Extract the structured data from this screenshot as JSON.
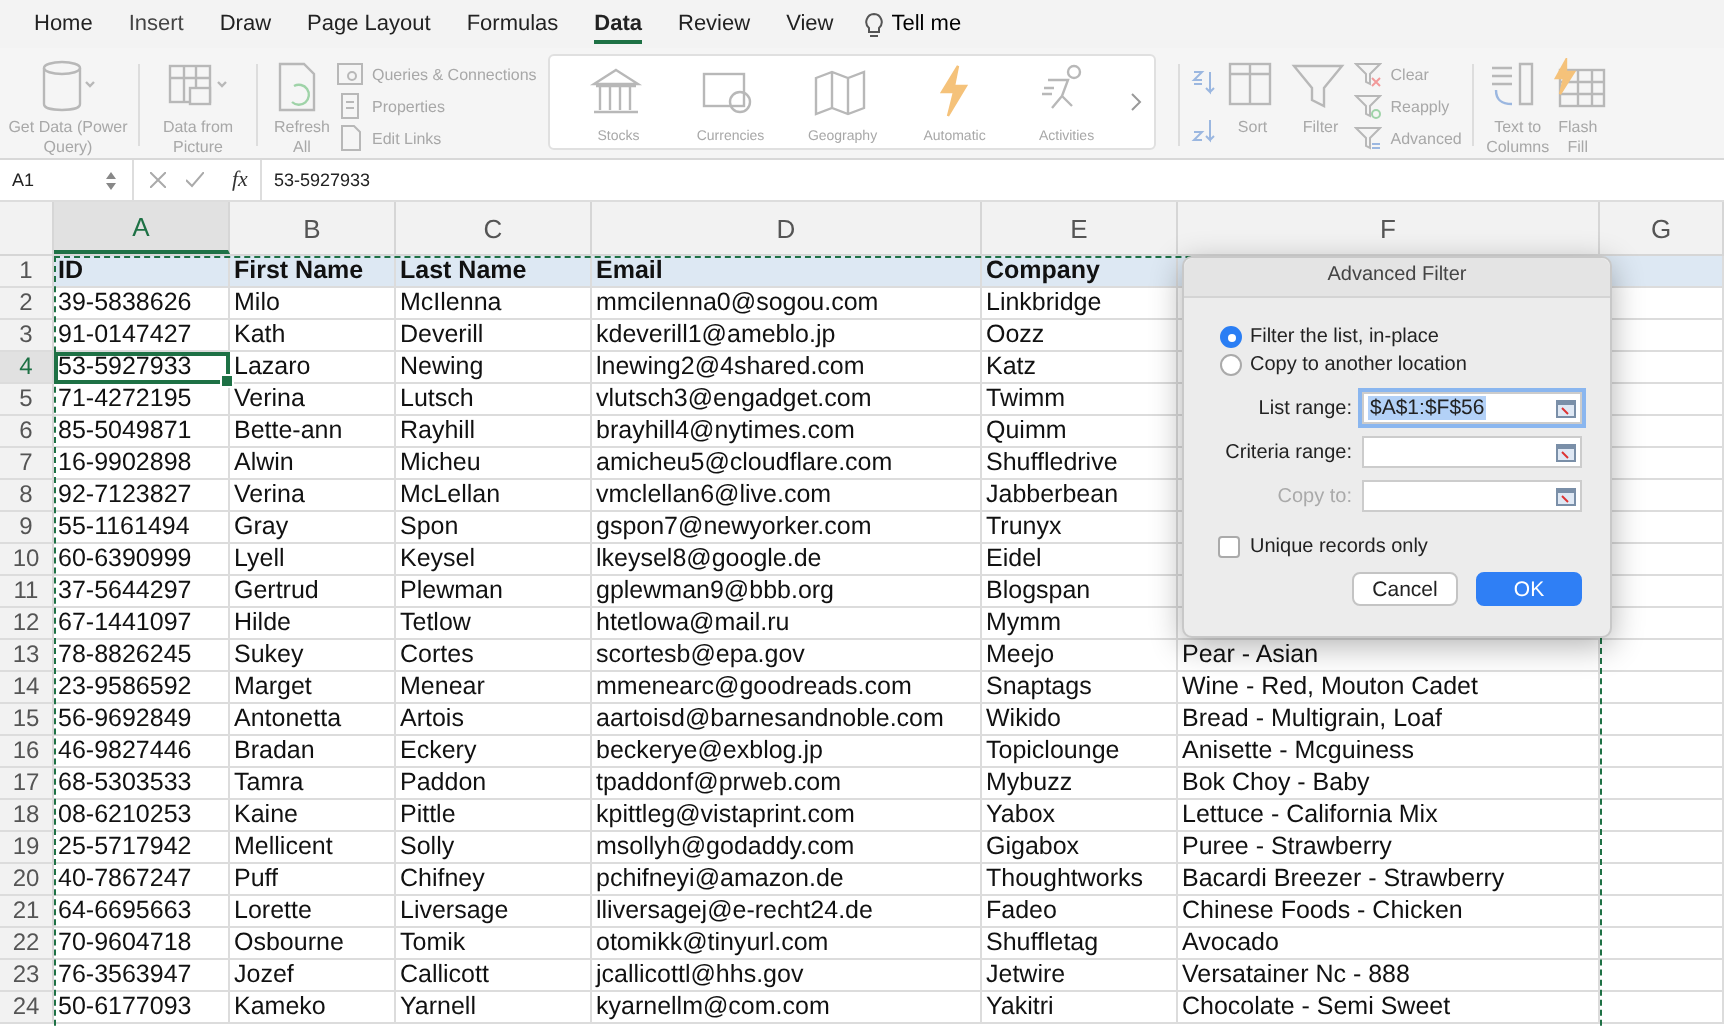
{
  "tabs": [
    {
      "label": "Home",
      "selected": false
    },
    {
      "label": "Insert",
      "selected": false
    },
    {
      "label": "Draw",
      "selected": false
    },
    {
      "label": "Page Layout",
      "selected": false
    },
    {
      "label": "Formulas",
      "selected": false
    },
    {
      "label": "Data",
      "selected": true
    },
    {
      "label": "Review",
      "selected": false
    },
    {
      "label": "View",
      "selected": false
    }
  ],
  "tell_me": "Tell me",
  "ribbon": {
    "get_data": "Get Data (Power Query)",
    "data_from_picture": "Data from Picture",
    "refresh_all": "Refresh All",
    "connections": [
      "Queries & Connections",
      "Properties",
      "Edit Links"
    ],
    "data_types": [
      "Stocks",
      "Currencies",
      "Geography",
      "Automatic",
      "Activities"
    ],
    "sort": "Sort",
    "filter": "Filter",
    "clear": "Clear",
    "reapply": "Reapply",
    "advanced": "Advanced",
    "text_to_columns": "Text to Columns",
    "flash_fill": "Flash Fill"
  },
  "formula_bar": {
    "name_box": "A1",
    "function_label": "fx",
    "formula": "53-5927933"
  },
  "columns": [
    {
      "label": "A",
      "selected": true
    },
    {
      "label": "B",
      "selected": false
    },
    {
      "label": "C",
      "selected": false
    },
    {
      "label": "D",
      "selected": false
    },
    {
      "label": "E",
      "selected": false
    },
    {
      "label": "F",
      "selected": false
    },
    {
      "label": "G",
      "selected": false
    }
  ],
  "rows": [
    {
      "number": "1",
      "selected": false,
      "kind": "header",
      "cells": [
        "ID",
        "First Name",
        "Last Name",
        "Email",
        "Company"
      ]
    },
    {
      "number": "2",
      "selected": false,
      "kind": "data",
      "cells": [
        "39-5838626",
        "Milo",
        "McIlenna",
        "mmcilenna0@sogou.com",
        "Linkbridge"
      ]
    },
    {
      "number": "3",
      "selected": false,
      "kind": "data",
      "cells": [
        "91-0147427",
        "Kath",
        "Deverill",
        "kdeverill1@ameblo.jp",
        "Oozz"
      ]
    },
    {
      "number": "4",
      "selected": true,
      "kind": "data",
      "cells": [
        "53-5927933",
        "Lazaro",
        "Newing",
        "lnewing2@4shared.com",
        "Katz"
      ]
    },
    {
      "number": "5",
      "selected": false,
      "kind": "data",
      "cells": [
        "71-4272195",
        "Verina",
        "Lutsch",
        "vlutsch3@engadget.com",
        "Twimm"
      ]
    },
    {
      "number": "6",
      "selected": false,
      "kind": "data",
      "cells": [
        "85-5049871",
        "Bette-ann",
        "Rayhill",
        "brayhill4@nytimes.com",
        "Quimm"
      ]
    },
    {
      "number": "7",
      "selected": false,
      "kind": "data",
      "cells": [
        "16-9902898",
        "Alwin",
        "Micheu",
        "amicheu5@cloudflare.com",
        "Shuffledrive"
      ]
    },
    {
      "number": "8",
      "selected": false,
      "kind": "data",
      "cells": [
        "92-7123827",
        "Verina",
        "McLellan",
        "vmclellan6@live.com",
        "Jabberbean"
      ]
    },
    {
      "number": "9",
      "selected": false,
      "kind": "data",
      "cells": [
        "55-1161494",
        "Gray",
        "Spon",
        "gspon7@newyorker.com",
        "Trunyx"
      ]
    },
    {
      "number": "10",
      "selected": false,
      "kind": "data",
      "cells": [
        "60-6390999",
        "Lyell",
        "Keysel",
        "lkeysel8@google.de",
        "Eidel"
      ]
    },
    {
      "number": "11",
      "selected": false,
      "kind": "data",
      "cells": [
        "37-5644297",
        "Gertrud",
        "Plewman",
        "gplewman9@bbb.org",
        "Blogspan"
      ]
    },
    {
      "number": "12",
      "selected": false,
      "kind": "data",
      "cells": [
        "67-1441097",
        "Hilde",
        "Tetlow",
        "htetlowa@mail.ru",
        "Mymm"
      ]
    },
    {
      "number": "13",
      "selected": false,
      "kind": "data",
      "cells": [
        "78-8826245",
        "Sukey",
        "Cortes",
        "scortesb@epa.gov",
        "Meejo",
        "Pear - Asian"
      ]
    },
    {
      "number": "14",
      "selected": false,
      "kind": "data",
      "cells": [
        "23-9586592",
        "Marget",
        "Menear",
        "mmenearc@goodreads.com",
        "Snaptags",
        "Wine - Red, Mouton Cadet"
      ]
    },
    {
      "number": "15",
      "selected": false,
      "kind": "data",
      "cells": [
        "56-9692849",
        "Antonetta",
        "Artois",
        "aartoisd@barnesandnoble.com",
        "Wikido",
        "Bread - Multigrain, Loaf"
      ]
    },
    {
      "number": "16",
      "selected": false,
      "kind": "data",
      "cells": [
        "46-9827446",
        "Bradan",
        "Eckery",
        "beckerye@exblog.jp",
        "Topiclounge",
        "Anisette - Mcguiness"
      ]
    },
    {
      "number": "17",
      "selected": false,
      "kind": "data",
      "cells": [
        "68-5303533",
        "Tamra",
        "Paddon",
        "tpaddonf@prweb.com",
        "Mybuzz",
        "Bok Choy - Baby"
      ]
    },
    {
      "number": "18",
      "selected": false,
      "kind": "data",
      "cells": [
        "08-6210253",
        "Kaine",
        "Pittle",
        "kpittleg@vistaprint.com",
        "Yabox",
        "Lettuce - California Mix"
      ]
    },
    {
      "number": "19",
      "selected": false,
      "kind": "data",
      "cells": [
        "25-5717942",
        "Mellicent",
        "Solly",
        "msollyh@godaddy.com",
        "Gigabox",
        "Puree - Strawberry"
      ]
    },
    {
      "number": "20",
      "selected": false,
      "kind": "data",
      "cells": [
        "40-7867247",
        "Puff",
        "Chifney",
        "pchifneyi@amazon.de",
        "Thoughtworks",
        "Bacardi Breezer - Strawberry"
      ]
    },
    {
      "number": "21",
      "selected": false,
      "kind": "data",
      "cells": [
        "64-6695663",
        "Lorette",
        "Liversage",
        "lliversagej@e-recht24.de",
        "Fadeo",
        "Chinese Foods - Chicken"
      ]
    },
    {
      "number": "22",
      "selected": false,
      "kind": "data",
      "cells": [
        "70-9604718",
        "Osbourne",
        "Tomik",
        "otomikk@tinyurl.com",
        "Shuffletag",
        "Avocado"
      ]
    },
    {
      "number": "23",
      "selected": false,
      "kind": "data",
      "cells": [
        "76-3563947",
        "Jozef",
        "Callicott",
        "jcallicottl@hhs.gov",
        "Jetwire",
        "Versatainer Nc - 888"
      ]
    },
    {
      "number": "24",
      "selected": false,
      "kind": "data",
      "cells": [
        "50-6177093",
        "Kameko",
        "Yarnell",
        "kyarnellm@com.com",
        "Yakitri",
        "Chocolate - Semi Sweet"
      ]
    }
  ],
  "dialog": {
    "title": "Advanced Filter",
    "options": [
      {
        "label": "Filter the list, in-place",
        "selected": true
      },
      {
        "label": "Copy to another location",
        "selected": false
      }
    ],
    "fields": [
      {
        "label": "List range:",
        "value": "$A$1:$F$56",
        "disabled": false,
        "focused": true
      },
      {
        "label": "Criteria range:",
        "disabled": false,
        "focused": false
      },
      {
        "label": "Copy to:",
        "disabled": true,
        "focused": false
      }
    ],
    "checkbox": {
      "label": "Unique records only",
      "checked": false
    },
    "buttons": [
      {
        "label": "Cancel",
        "kind": "secondary"
      },
      {
        "label": "OK",
        "kind": "primary"
      }
    ]
  }
}
